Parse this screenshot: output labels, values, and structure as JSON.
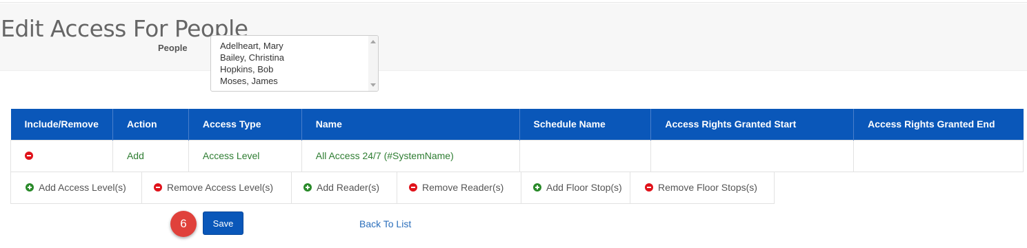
{
  "page": {
    "title": "Edit Access For People"
  },
  "people": {
    "label": "People",
    "items": [
      "Adelheart, Mary",
      "Bailey, Christina",
      "Hopkins, Bob",
      "Moses, James"
    ]
  },
  "table": {
    "headers": [
      "Include/Remove",
      "Action",
      "Access Type",
      "Name",
      "Schedule Name",
      "Access Rights Granted Start",
      "Access Rights Granted End"
    ],
    "rows": [
      {
        "include_icon": "remove-circle-icon",
        "action": "Add",
        "access_type": "Access Level",
        "name": "All Access 24/7 (#SystemName)",
        "schedule_name": "",
        "start": "",
        "end": ""
      }
    ]
  },
  "toolbar": {
    "add_access_levels": "Add Access Level(s)",
    "remove_access_levels": "Remove Access Level(s)",
    "add_readers": "Add Reader(s)",
    "remove_readers": "Remove Reader(s)",
    "add_floor_stops": "Add Floor Stop(s)",
    "remove_floor_stops": "Remove Floor Stops(s)"
  },
  "footer": {
    "step_number": "6",
    "save_label": "Save",
    "back_label": "Back To List"
  },
  "colors": {
    "primary": "#0a57b9",
    "add": "#2a8a2a",
    "remove": "#e0121a",
    "badge": "#e0413b",
    "row_text": "#2e7d32"
  }
}
